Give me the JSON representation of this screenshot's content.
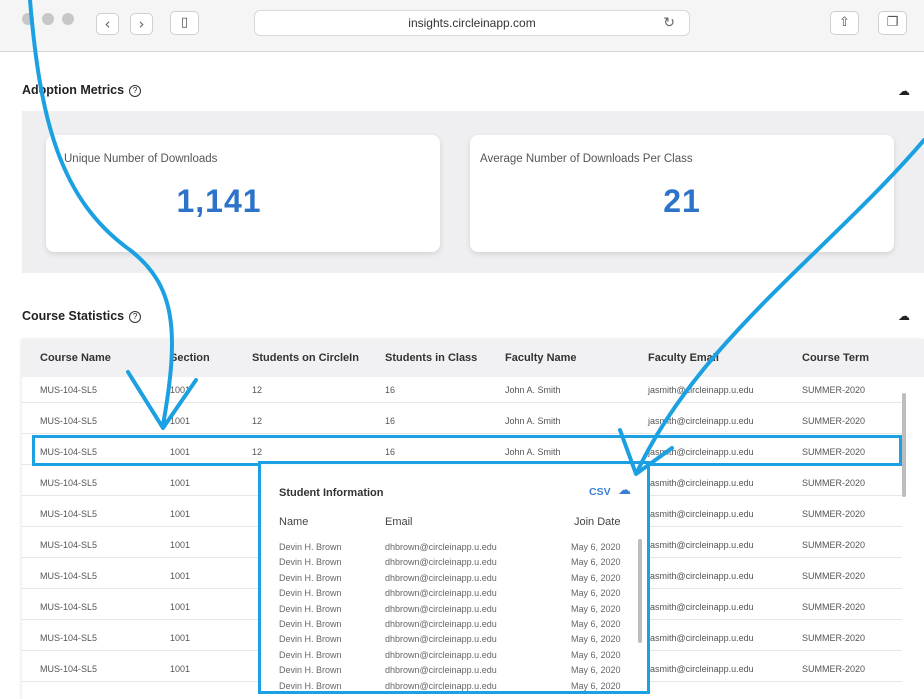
{
  "browser": {
    "url": "insights.circleinapp.com",
    "back": "‹",
    "forward": "›"
  },
  "adoption": {
    "title": "Adoption Metrics",
    "cards": [
      {
        "label": "Unique Number of Downloads",
        "value": "1,141"
      },
      {
        "label": "Average Number of Downloads Per Class",
        "value": "21"
      }
    ]
  },
  "course_stats": {
    "title": "Course Statistics",
    "columns": [
      "Course Name",
      "Section",
      "Students on CircleIn",
      "Students in Class",
      "Faculty Name",
      "Faculty Email",
      "Course Term"
    ],
    "rows": [
      [
        "MUS-104-SL5",
        "1001",
        "12",
        "16",
        "John A. Smith",
        "jasmith@circleinapp.u.edu",
        "SUMMER-2020"
      ],
      [
        "MUS-104-SL5",
        "1001",
        "12",
        "16",
        "John A. Smith",
        "jasmith@circleinapp.u.edu",
        "SUMMER-2020"
      ],
      [
        "MUS-104-SL5",
        "1001",
        "12",
        "16",
        "John A. Smith",
        "jasmith@circleinapp.u.edu",
        "SUMMER-2020"
      ],
      [
        "MUS-104-SL5",
        "1001",
        "",
        "",
        "",
        "jasmith@circleinapp.u.edu",
        "SUMMER-2020"
      ],
      [
        "MUS-104-SL5",
        "1001",
        "",
        "",
        "",
        "jasmith@circleinapp.u.edu",
        "SUMMER-2020"
      ],
      [
        "MUS-104-SL5",
        "1001",
        "",
        "",
        "",
        "jasmith@circleinapp.u.edu",
        "SUMMER-2020"
      ],
      [
        "MUS-104-SL5",
        "1001",
        "",
        "",
        "",
        "jasmith@circleinapp.u.edu",
        "SUMMER-2020"
      ],
      [
        "MUS-104-SL5",
        "1001",
        "",
        "",
        "",
        "jasmith@circleinapp.u.edu",
        "SUMMER-2020"
      ],
      [
        "MUS-104-SL5",
        "1001",
        "",
        "",
        "",
        "jasmith@circleinapp.u.edu",
        "SUMMER-2020"
      ],
      [
        "MUS-104-SL5",
        "1001",
        "",
        "",
        "",
        "jasmith@circleinapp.u.edu",
        "SUMMER-2020"
      ]
    ]
  },
  "student_popup": {
    "title": "Student Information",
    "csv_label": "CSV",
    "columns": [
      "Name",
      "Email",
      "Join Date"
    ],
    "rows": [
      [
        "Devin H. Brown",
        "dhbrown@circleinapp.u.edu",
        "May 6, 2020"
      ],
      [
        "Devin H. Brown",
        "dhbrown@circleinapp.u.edu",
        "May 6, 2020"
      ],
      [
        "Devin H. Brown",
        "dhbrown@circleinapp.u.edu",
        "May 6, 2020"
      ],
      [
        "Devin H. Brown",
        "dhbrown@circleinapp.u.edu",
        "May 6, 2020"
      ],
      [
        "Devin H. Brown",
        "dhbrown@circleinapp.u.edu",
        "May 6, 2020"
      ],
      [
        "Devin H. Brown",
        "dhbrown@circleinapp.u.edu",
        "May 6, 2020"
      ],
      [
        "Devin H. Brown",
        "dhbrown@circleinapp.u.edu",
        "May 6, 2020"
      ],
      [
        "Devin H. Brown",
        "dhbrown@circleinapp.u.edu",
        "May 6, 2020"
      ],
      [
        "Devin H. Brown",
        "dhbrown@circleinapp.u.edu",
        "May 6, 2020"
      ],
      [
        "Devin H. Brown",
        "dhbrown@circleinapp.u.edu",
        "May 6, 2020"
      ]
    ]
  },
  "colors": {
    "accent_blue": "#2c73c9",
    "annotation_cyan": "#1ba1e2"
  }
}
